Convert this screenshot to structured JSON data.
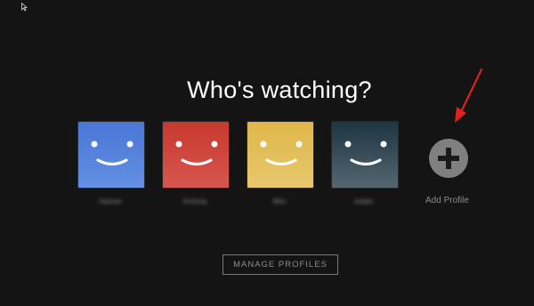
{
  "header": {
    "title": "Who's watching?"
  },
  "profiles": [
    {
      "name": "Hamen",
      "color_top": "#4a76d6",
      "color_bottom": "#5f8ee4"
    },
    {
      "name": "Antonia",
      "color_top": "#c8382f",
      "color_bottom": "#d4544c"
    },
    {
      "name": "Mim",
      "color_top": "#e0b94b",
      "color_bottom": "#e6c66a"
    },
    {
      "name": "Isdian",
      "color_top": "#1e3744",
      "color_bottom": "#4d5f6a"
    }
  ],
  "add_profile": {
    "label": "Add Profile",
    "icon": "plus-icon"
  },
  "manage_button": {
    "label": "MANAGE PROFILES"
  },
  "annotation": {
    "icon": "red-arrow-icon",
    "color": "#e02020"
  }
}
